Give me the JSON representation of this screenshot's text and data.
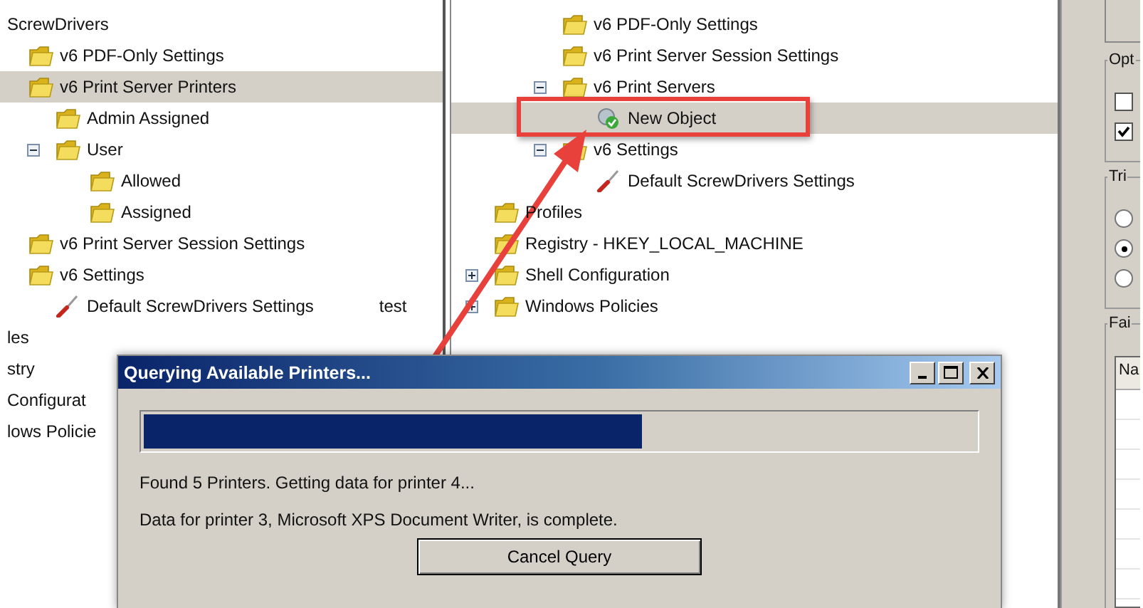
{
  "left_tree": {
    "items": [
      {
        "label": "ScrewDrivers",
        "kind": "text",
        "selected": false,
        "children": [
          {
            "label": "v6 PDF-Only Settings",
            "kind": "folder",
            "selected": false
          },
          {
            "label": "v6 Print Server Printers",
            "kind": "folder",
            "selected": true,
            "children": [
              {
                "label": "Admin Assigned",
                "kind": "folder",
                "selected": false
              },
              {
                "label": "User",
                "kind": "folder",
                "selected": false,
                "expanded": true,
                "children": [
                  {
                    "label": "Allowed",
                    "kind": "folder",
                    "selected": false
                  },
                  {
                    "label": "Assigned",
                    "kind": "folder",
                    "selected": false
                  }
                ]
              }
            ]
          },
          {
            "label": "v6 Print Server Session Settings",
            "kind": "folder",
            "selected": false
          },
          {
            "label": "v6 Settings",
            "kind": "folder",
            "selected": false,
            "children": [
              {
                "label": "Default ScrewDrivers Settings",
                "kind": "settings",
                "selected": false,
                "value": "test"
              }
            ]
          }
        ]
      },
      {
        "label": "les",
        "kind": "text",
        "selected": false
      },
      {
        "label": "stry",
        "kind": "text",
        "selected": false
      },
      {
        "label": "Configurat",
        "kind": "text",
        "selected": false
      },
      {
        "label": "lows Policie",
        "kind": "text",
        "selected": false
      }
    ]
  },
  "middle_tree": {
    "nested_items": [
      {
        "label": "v6 PDF-Only Settings",
        "kind": "folder",
        "selected": false
      },
      {
        "label": "v6 Print Server Session Settings",
        "kind": "folder",
        "selected": false
      },
      {
        "label": "v6 Print Servers",
        "kind": "folder",
        "selected": false,
        "expanded": true,
        "children": [
          {
            "label": "New Object",
            "kind": "object",
            "selected": true
          }
        ]
      },
      {
        "label": "v6 Settings",
        "kind": "folder",
        "selected": false,
        "expanded": true,
        "children": [
          {
            "label": "Default ScrewDrivers Settings",
            "kind": "settings",
            "selected": false
          }
        ]
      }
    ],
    "items": [
      {
        "label": "Profiles",
        "kind": "folder",
        "selected": false
      },
      {
        "label": "Registry - HKEY_LOCAL_MACHINE",
        "kind": "folder",
        "selected": false
      },
      {
        "label": "Shell Configuration",
        "kind": "folder",
        "selected": false,
        "expanded": false
      },
      {
        "label": "Windows Policies",
        "kind": "folder",
        "selected": false,
        "expanded": false
      }
    ]
  },
  "right_panel": {
    "groups": [
      {
        "label": "Opt",
        "kind": "checkboxes",
        "controls": [
          {
            "checked": false
          },
          {
            "checked": true
          }
        ]
      },
      {
        "label": "Tri",
        "kind": "radios",
        "controls": [
          {
            "selected": false
          },
          {
            "selected": true
          },
          {
            "selected": false
          }
        ]
      },
      {
        "label": "Fai",
        "kind": "list",
        "column": "Na"
      }
    ]
  },
  "dialog": {
    "title": "Querying Available Printers...",
    "progress": {
      "level": 0.6
    },
    "status_lines": [
      "Found 5 Printers.  Getting data for printer 4...",
      "Data for printer 3, Microsoft XPS Document Writer, is complete."
    ],
    "button": "Cancel Query"
  }
}
